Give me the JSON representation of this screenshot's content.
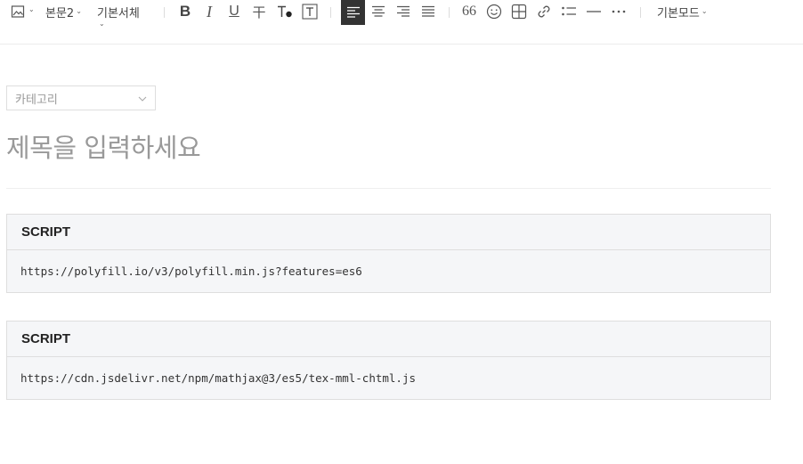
{
  "toolbar": {
    "image_icon": "image-icon",
    "paragraph_style": "본문2",
    "font_family": "기본서체",
    "bold_glyph": "B",
    "italic_glyph": "I",
    "underline_glyph": "U",
    "strike_glyph": "干",
    "mode_label": "기본모드",
    "active_alignment": "align-left",
    "quote_glyph": "66"
  },
  "editor": {
    "category_placeholder": "카테고리",
    "title_placeholder": "제목을 입력하세요"
  },
  "blocks": [
    {
      "type_label": "SCRIPT",
      "src": "https://polyfill.io/v3/polyfill.min.js?features=es6"
    },
    {
      "type_label": "SCRIPT",
      "src": "https://cdn.jsdelivr.net/npm/mathjax@3/es5/tex-mml-chtml.js"
    }
  ]
}
